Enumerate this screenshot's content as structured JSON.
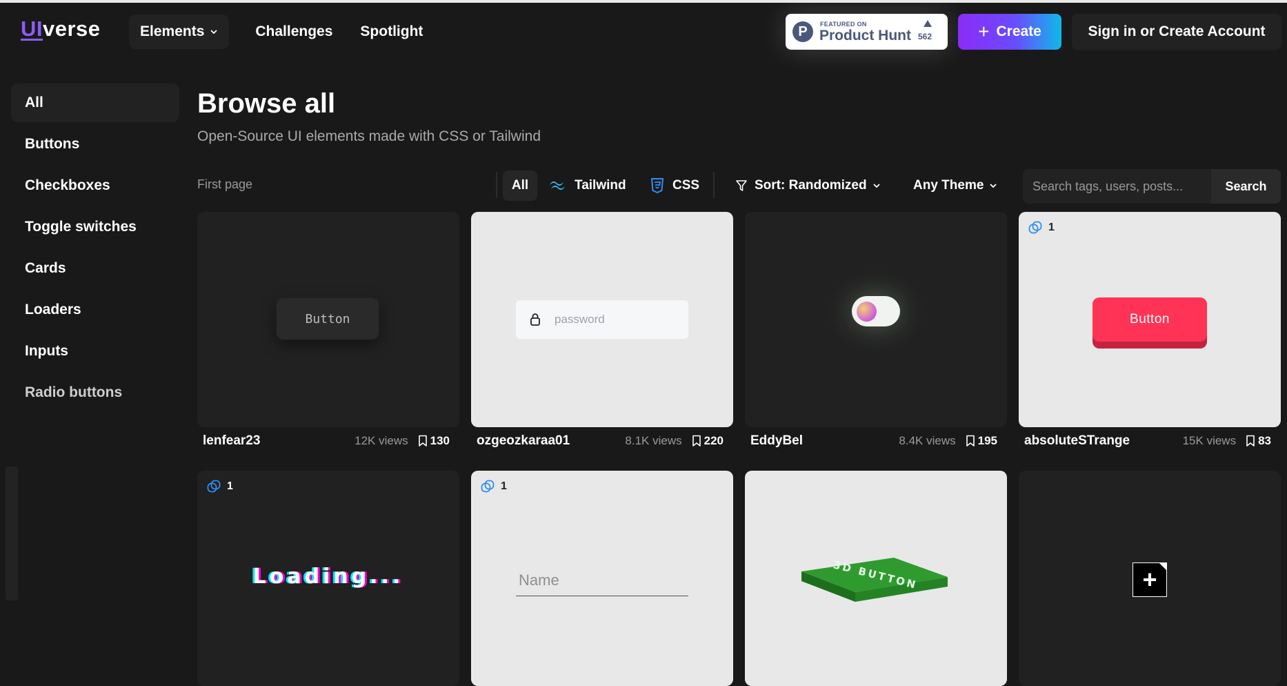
{
  "header": {
    "logo": {
      "ui": "UI",
      "verse": "verse"
    },
    "nav": [
      {
        "label": "Elements",
        "has_dropdown": true
      },
      {
        "label": "Challenges"
      },
      {
        "label": "Spotlight"
      }
    ],
    "product_hunt": {
      "featured": "FEATURED ON",
      "name": "Product Hunt",
      "count": "562"
    },
    "create_label": "Create",
    "signin_label": "Sign in or Create Account"
  },
  "sidebar": {
    "items": [
      {
        "label": "All",
        "active": true
      },
      {
        "label": "Buttons"
      },
      {
        "label": "Checkboxes"
      },
      {
        "label": "Toggle switches"
      },
      {
        "label": "Cards"
      },
      {
        "label": "Loaders"
      },
      {
        "label": "Inputs"
      },
      {
        "label": "Radio buttons"
      }
    ]
  },
  "main": {
    "title": "Browse all",
    "subtitle": "Open-Source UI elements made with CSS or Tailwind",
    "pagination_label": "First page",
    "filters": {
      "all": "All",
      "tailwind": "Tailwind",
      "css": "CSS"
    },
    "sort_label": "Sort: Randomized",
    "theme_label": "Any Theme",
    "search": {
      "placeholder": "Search tags, users, posts...",
      "button": "Search"
    }
  },
  "cards": [
    {
      "author": "lenfear23",
      "views": "12K views",
      "saves": "130",
      "preview_text": "Button",
      "theme": "dark"
    },
    {
      "author": "ozgeozkaraa01",
      "views": "8.1K views",
      "saves": "220",
      "preview_text": "password",
      "theme": "light"
    },
    {
      "author": "EddyBel",
      "views": "8.4K views",
      "saves": "195",
      "preview_text": "",
      "theme": "dark"
    },
    {
      "author": "absoluteSTrange",
      "views": "15K views",
      "saves": "83",
      "preview_text": "Button",
      "variants": "1",
      "theme": "light"
    },
    {
      "preview_text": "Loading...",
      "variants": "1",
      "theme": "dark"
    },
    {
      "preview_text": "Name",
      "variants": "1",
      "theme": "light"
    },
    {
      "preview_text": "3D BUTTON",
      "theme": "light"
    },
    {
      "preview_text": "+",
      "theme": "dark"
    }
  ],
  "colors": {
    "background": "#191919",
    "accent_purple": "#8b5cf6",
    "create_gradient_start": "#8b2cf5",
    "create_gradient_end": "#0fb9e8",
    "tailwind_icon": "#38bdf8",
    "css_icon": "#2f8ff0",
    "red_button": "#ff3355"
  },
  "icons": [
    "chevron-down-icon",
    "producthunt-logo-icon",
    "plus-icon",
    "tailwind-icon",
    "css3-icon",
    "filter-icon",
    "bookmark-icon",
    "lock-icon",
    "variants-icon"
  ]
}
